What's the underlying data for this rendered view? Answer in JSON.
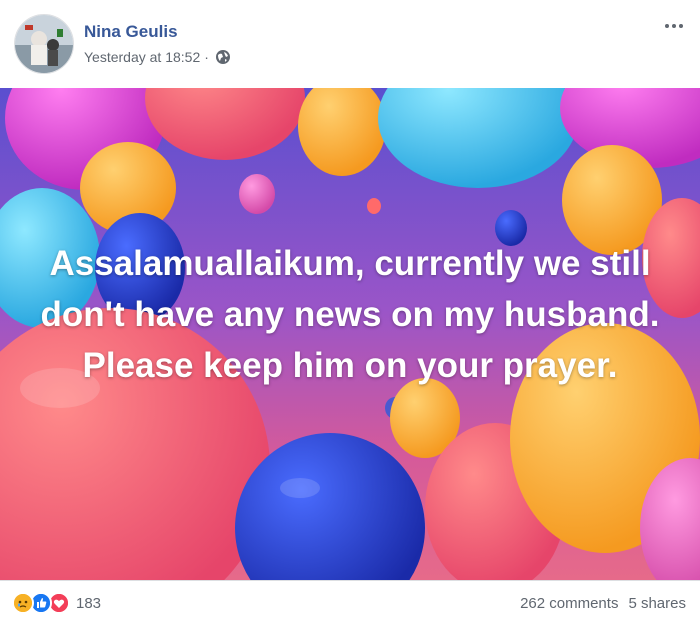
{
  "post": {
    "author": "Nina Geulis",
    "timestamp": "Yesterday at 18:52",
    "separator": "·",
    "privacy_icon": "globe-icon",
    "menu_icon": "more-options-icon"
  },
  "image": {
    "overlay_text": "Assalamuallaikum, currently we still don't have any news on my husband. Please keep him on your prayer.",
    "background": "balloons"
  },
  "footer": {
    "reaction_icons": [
      "sad-icon",
      "like-icon",
      "love-icon"
    ],
    "reaction_count": "183",
    "comments": "262 comments",
    "shares": "5 shares"
  },
  "colors": {
    "author_link": "#385898",
    "meta_text": "#606770",
    "like_blue": "#1877f2",
    "love_red": "#f33e58",
    "sad_yellow": "#f7b125"
  }
}
